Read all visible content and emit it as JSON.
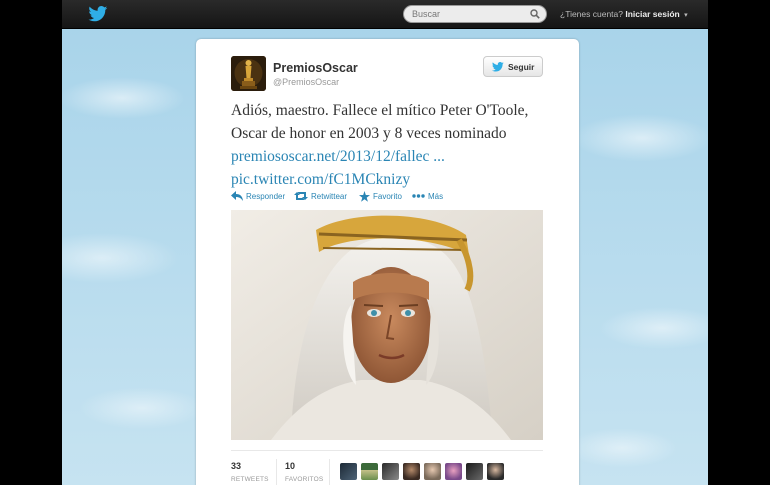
{
  "topbar": {
    "search_placeholder": "Buscar",
    "login_prompt": "¿Tienes cuenta?",
    "login_link": "Iniciar sesión",
    "caret": "▾"
  },
  "tweet": {
    "display_name": "PremiosOscar",
    "handle": "@PremiosOscar",
    "follow_label": "Seguir",
    "text": "Adiós, maestro. Fallece el mítico Peter O'Toole, Oscar de honor en 2003 y 8 veces nominado ",
    "link_1": "premiososcar.net/2013/12/fallec ...",
    "link_2": "pic.twitter.com/fC1MCknizy",
    "actions": {
      "reply": "Responder",
      "retweet": "Retwittear",
      "favorite": "Favorito",
      "more": "Más"
    },
    "stats": {
      "retweets_count": "33",
      "retweets_label": "RETWEETS",
      "favorites_count": "10",
      "favorites_label": "FAVORITOS"
    }
  },
  "colors": {
    "link": "#2a85b4",
    "background": "#c0deed",
    "topbar": "#1b1b1b"
  },
  "icons": [
    "twitter-bird-icon",
    "search-icon",
    "reply-icon",
    "retweet-icon",
    "star-icon",
    "more-icon"
  ]
}
